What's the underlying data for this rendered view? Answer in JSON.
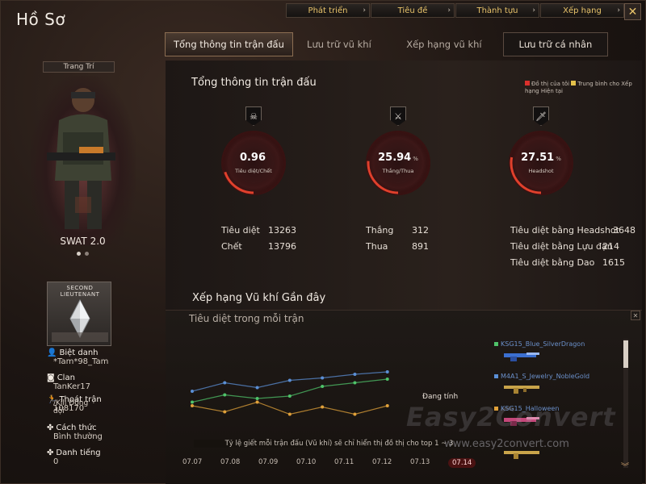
{
  "window": {
    "title": "Hồ Sơ"
  },
  "topnav": [
    "Phát triển",
    "Tiêu đề",
    "Thành tựu",
    "Xếp hạng"
  ],
  "tabs": [
    "Tổng thông tin trận đấu",
    "Lưu trữ vũ khí",
    "Xếp hạng vũ khí",
    "Lưu trữ cá nhân"
  ],
  "profile": {
    "decorate_label": "Trang Trí",
    "character_name": "SWAT 2.0",
    "rank_text": [
      "SECOND",
      "LIEUTENANT"
    ],
    "nickname_label": "Biệt danh",
    "nickname": "*Tam*98_Tam",
    "clan_label": "Clan",
    "clan": "TanKer17",
    "escape_label": "Thoát trận",
    "escape_overlay": "/Kill Đồng đội",
    "escape_value": "108170",
    "method_label": "Cách thức",
    "method": "Bình thường",
    "fame_label": "Danh tiếng",
    "fame": "0"
  },
  "summary": {
    "title": "Tổng thông tin trận đấu",
    "legend_mine": "Đồ thị của tôi",
    "legend_avg": "Trung bình cho Xếp hạng Hiện tại",
    "legend_mine_color": "#d9302c",
    "legend_avg_color": "#e3c04a",
    "circles": [
      {
        "value": "0.96",
        "pct": "",
        "label": "Tiêu diệt/Chết",
        "fill": 0.2,
        "badge": "skull-icon"
      },
      {
        "value": "25.94",
        "pct": "%",
        "label": "Thắng/Thua",
        "fill": 0.26,
        "badge": "crossed-swords-icon"
      },
      {
        "value": "27.51",
        "pct": "%",
        "label": "Headshot",
        "fill": 0.28,
        "badge": "knife-icon"
      }
    ],
    "kills_label": "Tiêu diệt",
    "kills": "13263",
    "deaths_label": "Chết",
    "deaths": "13796",
    "wins_label": "Thắng",
    "wins": "312",
    "losses_label": "Thua",
    "losses": "891",
    "hs_kills_label": "Tiêu diệt bằng Headshot",
    "hs_kills": "3648",
    "grenade_kills_label": "Tiêu diệt bằng Lựu đạn",
    "grenade_kills": "214",
    "knife_kills_label": "Tiêu diệt bằng Dao",
    "knife_kills": "1615"
  },
  "weapon_rank": {
    "title": "Xếp hạng Vũ khí Gần đây",
    "subtitle": "Tiêu diệt trong mỗi trận",
    "note": "Tỷ lệ giết mỗi trận đấu (Vũ khí) sẽ chỉ hiển thị đồ thị cho top 1 ~ 3",
    "status": "Đang tính",
    "weapons": [
      {
        "name": "KSG15_Blue_SilverDragon",
        "color": "#4fc36a"
      },
      {
        "name": "M4A1_S_Jewelry_NobleGold",
        "color": "#5b8fd6"
      },
      {
        "name": "KSG15_Halloween",
        "color": "#e0a13a"
      }
    ]
  },
  "watermark": {
    "logo": "Easy2Convert",
    "url": "www.easy2convert.com"
  },
  "chart_data": {
    "type": "line",
    "title": "",
    "subtitle": "Tiêu diệt trong mỗi trận",
    "categories": [
      "07.07",
      "07.08",
      "07.09",
      "07.10",
      "07.11",
      "07.12",
      "07.13",
      "07.14"
    ],
    "highlighted_category": "07.14",
    "series": [
      {
        "name": "KSG15_Blue_SilverDragon",
        "color": "#5b8fd6",
        "values": [
          4.2,
          4.9,
          4.5,
          5.1,
          5.3,
          5.6,
          5.8,
          null
        ]
      },
      {
        "name": "M4A1_S_Jewelry_NobleGold",
        "color": "#4fc36a",
        "values": [
          3.3,
          3.9,
          3.6,
          3.8,
          4.6,
          4.9,
          5.2,
          null
        ]
      },
      {
        "name": "KSG15_Halloween",
        "color": "#e0a13a",
        "values": [
          3.0,
          2.5,
          3.3,
          2.3,
          2.9,
          2.3,
          3.0,
          null
        ]
      }
    ],
    "ylim": [
      0,
      8
    ],
    "grid": false
  }
}
